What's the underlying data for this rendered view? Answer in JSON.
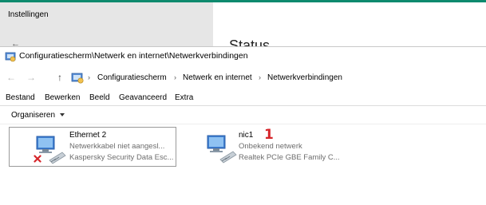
{
  "settings": {
    "title": "Instellingen",
    "back_arrow": "←",
    "heading": "Status"
  },
  "window": {
    "title": "Configuratiescherm\\Netwerk en internet\\Netwerkverbindingen"
  },
  "address": {
    "back": "←",
    "forward": "→",
    "up": "↑",
    "separator": "›",
    "crumbs": [
      "Configuratiescherm",
      "Netwerk en internet",
      "Netwerkverbindingen"
    ]
  },
  "menu": [
    "Bestand",
    "Bewerken",
    "Beeld",
    "Geavanceerd",
    "Extra"
  ],
  "toolbar": {
    "organize_label": "Organiseren"
  },
  "connections": [
    {
      "name": "Ethernet 2",
      "status": "Netwerkkabel niet aangesl...",
      "device": "Kaspersky Security Data Esc...",
      "disconnected": true
    },
    {
      "name": "nic1",
      "status": "Onbekend netwerk",
      "device": "Realtek PCIe GBE Family C...",
      "disconnected": false
    }
  ],
  "annotation": {
    "marker": "1",
    "color": "#d6262b"
  },
  "colors": {
    "accent": "#0e8a6e",
    "sidebar": "#e6e6e6",
    "subtext": "#6d6d6d"
  }
}
